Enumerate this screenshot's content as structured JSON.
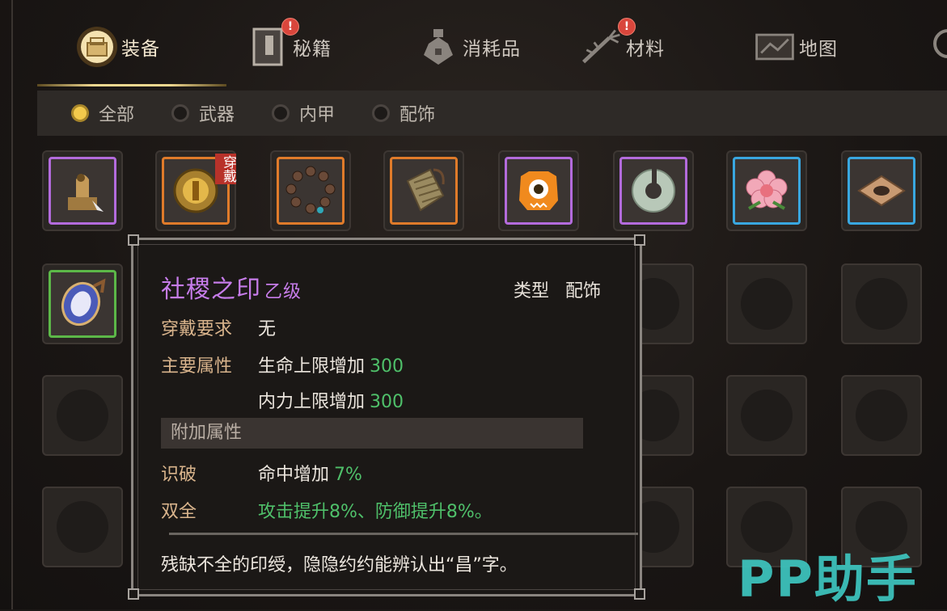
{
  "tabs": [
    {
      "label": "装备",
      "icon": "equipment-bag-icon",
      "badge": "",
      "active": true
    },
    {
      "label": "秘籍",
      "icon": "secret-book-icon",
      "badge": "!",
      "active": false
    },
    {
      "label": "消耗品",
      "icon": "potion-icon",
      "badge": "",
      "active": false
    },
    {
      "label": "材料",
      "icon": "ginseng-root-icon",
      "badge": "!",
      "active": false
    },
    {
      "label": "地图",
      "icon": "map-scroll-icon",
      "badge": "",
      "active": false
    }
  ],
  "filters": [
    {
      "label": "全部",
      "selected": true
    },
    {
      "label": "武器",
      "selected": false
    },
    {
      "label": "内甲",
      "selected": false
    },
    {
      "label": "配饰",
      "selected": false
    }
  ],
  "items_row1": [
    {
      "icon": "jade-seal-icon",
      "rarity": "purple",
      "worn": false
    },
    {
      "icon": "golden-amulet-icon",
      "rarity": "orange",
      "worn": true
    },
    {
      "icon": "prayer-beads-icon",
      "rarity": "orange",
      "worn": false
    },
    {
      "icon": "bamboo-armor-icon",
      "rarity": "orange",
      "worn": false
    },
    {
      "icon": "one-eyed-monster-icon",
      "rarity": "purple",
      "worn": false
    },
    {
      "icon": "jade-ring-icon",
      "rarity": "purple",
      "worn": false
    },
    {
      "icon": "flower-icon",
      "rarity": "blue",
      "worn": false
    },
    {
      "icon": "diamond-leather-icon",
      "rarity": "blue",
      "worn": false
    }
  ],
  "items_row2_first": {
    "icon": "mirror-icon",
    "rarity": "green"
  },
  "worn_tag": "穿戴",
  "tooltip": {
    "name": "社稷之印",
    "grade": "乙级",
    "type_label": "类型",
    "type_value": "配饰",
    "req_label": "穿戴要求",
    "req_value": "无",
    "main_label": "主要属性",
    "main1_name": "生命上限增加",
    "main1_value": "300",
    "main2_name": "内力上限增加",
    "main2_value": "300",
    "extra_head": "附加属性",
    "extra1_label": "识破",
    "extra1_name": "命中增加",
    "extra1_value": "7%",
    "extra2_label": "双全",
    "extra2_value": "攻击提升8%、防御提升8%。",
    "description": "残缺不全的印绶，隐隐约约能辨认出“昌”字。"
  },
  "watermark": "PP助手",
  "colors": {
    "purple": "#b36bdc",
    "orange": "#e07b2a",
    "blue": "#39a7e0",
    "green": "#5cb848",
    "value_green": "#4fc06a"
  }
}
